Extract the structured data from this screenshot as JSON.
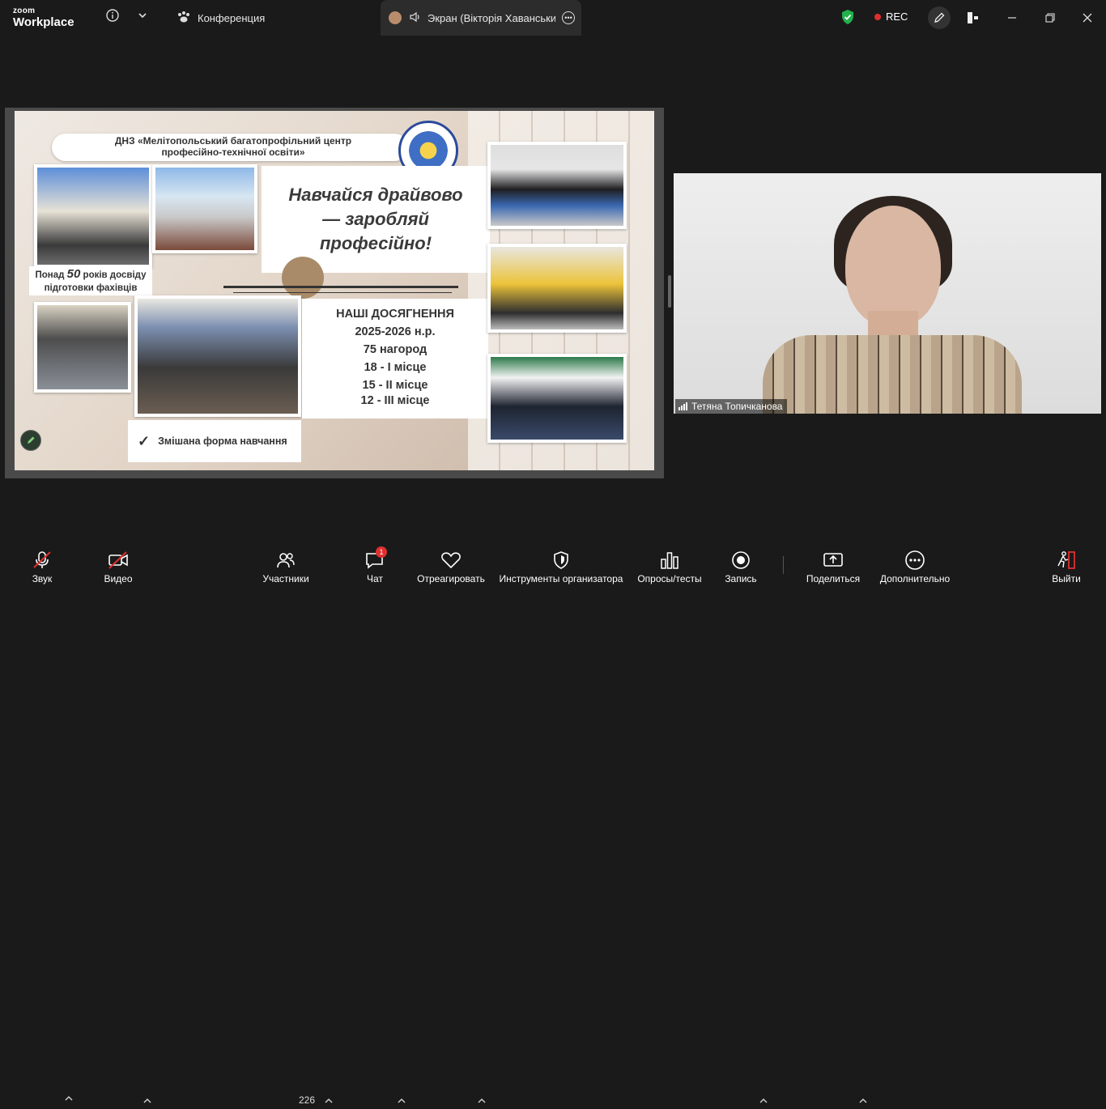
{
  "app": {
    "logo_top": "zoom",
    "logo_bottom": "Workplace"
  },
  "tabs": {
    "conference": "Конференция",
    "screen": "Экран (Вікторія Хаванських)"
  },
  "status": {
    "rec": "REC"
  },
  "slide": {
    "header": "ДНЗ «Мелітопольський багатопрофільний центр професійно-технічної освіти»",
    "motto_line1": "Навчайся драйвово",
    "motto_line2": "— заробляй",
    "motto_line3": "професійно!",
    "caption_pre": "Понад ",
    "caption_num": "50",
    "caption_post": " років досвіду",
    "caption_line2": "підготовки фахівців",
    "achievements_title": "НАШІ ДОСЯГНЕННЯ",
    "achievements_year": "2025-2026 н.р.",
    "achievements_total": "75 нагород",
    "place1": "18 - І місце",
    "place2": "15 - ІІ місце",
    "place3": "12 - ІІІ місце",
    "mixed_form": "Змішана форма навчання",
    "check": "✓"
  },
  "participant": {
    "name": "Тетяна Топичканова"
  },
  "toolbar": {
    "audio": "Звук",
    "video": "Видео",
    "participants": "Участники",
    "participants_count": "226",
    "chat": "Чат",
    "chat_badge": "1",
    "react": "Отреагировать",
    "host_tools": "Инструменты организатора",
    "polls": "Опросы/тесты",
    "record": "Запись",
    "share": "Поделиться",
    "more": "Дополнительно",
    "leave": "Выйти"
  },
  "colors": {
    "rec_dot": "#e02f2f",
    "shield": "#22b14c",
    "leave": "#e02f2f"
  }
}
